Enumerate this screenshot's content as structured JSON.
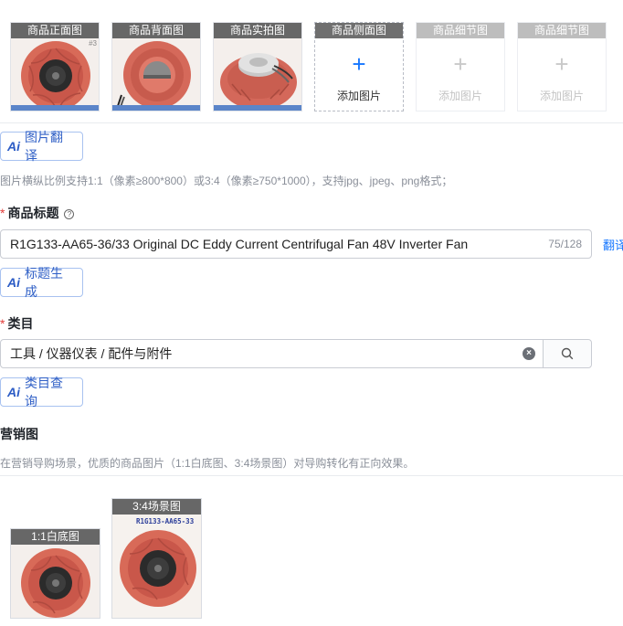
{
  "main_images": {
    "slots": [
      {
        "caption": "商品正面图",
        "watermark": "#3"
      },
      {
        "caption": "商品背面图"
      },
      {
        "caption": "商品实拍图"
      },
      {
        "caption": "商品侧面图",
        "add_label": "添加图片",
        "plus": "+"
      },
      {
        "caption": "商品细节图",
        "add_label": "添加图片",
        "plus": "+"
      },
      {
        "caption": "商品细节图",
        "add_label": "添加图片",
        "plus": "+"
      }
    ],
    "translate_button": {
      "ai": "Ai",
      "label": "图片翻译"
    },
    "hint": "图片横纵比例支持1:1（像素≥800*800）或3:4（像素≥750*1000），支持jpg、jpeg、png格式；"
  },
  "title_field": {
    "required_mark": "*",
    "label": "商品标题",
    "help": "?",
    "value": "R1G133-AA65-36/33 Original DC Eddy Current Centrifugal Fan 48V Inverter Fan",
    "count": "75/128",
    "translate_link": "翻译",
    "generate_button": {
      "ai": "Ai",
      "label": "标题生成"
    }
  },
  "category_field": {
    "required_mark": "*",
    "label": "类目",
    "value": "工具 / 仪器仪表 / 配件与附件",
    "clear": "×",
    "query_button": {
      "ai": "Ai",
      "label": "类目查询"
    }
  },
  "marketing": {
    "label": "营销图",
    "hint": "在营销导购场景，优质的商品图片（1:1白底图、3:4场景图）对导购转化有正向效果。",
    "slots": [
      {
        "caption": "1:1白底图"
      },
      {
        "caption": "3:4场景图",
        "overlay_text": "R1G133-AA65-33"
      }
    ]
  },
  "colors": {
    "accent": "#1677ff",
    "fan_red": "#d86a58",
    "required": "#e23c39"
  }
}
